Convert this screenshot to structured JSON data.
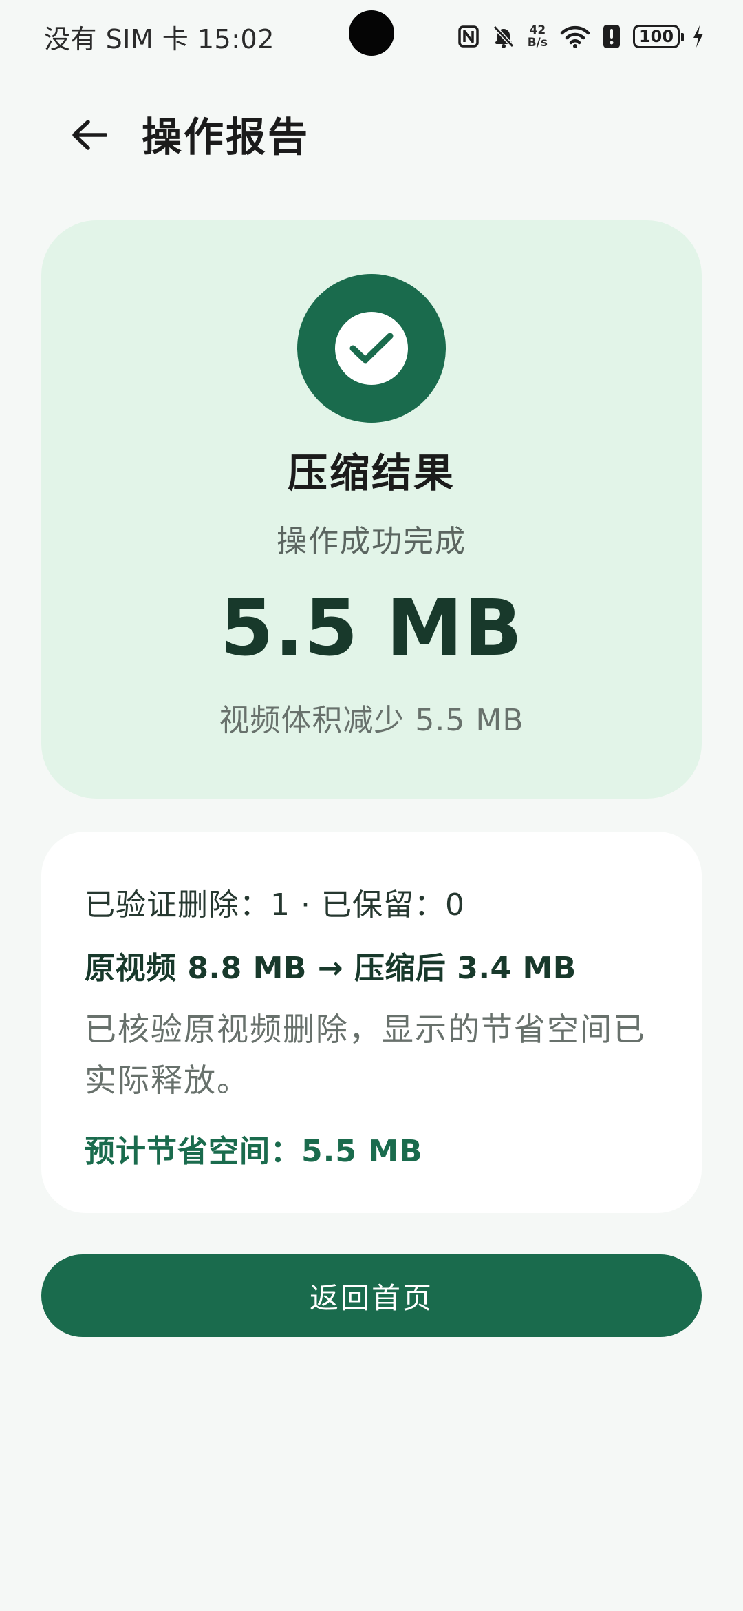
{
  "status_bar": {
    "carrier": "没有 SIM 卡",
    "time": "15:02",
    "net_speed_value": "42",
    "net_speed_unit": "B/s",
    "battery_level": "100",
    "icons": [
      "nfc-icon",
      "bell-off-icon",
      "wifi-icon",
      "alert-icon",
      "battery-icon",
      "charging-icon"
    ]
  },
  "app_bar": {
    "title": "操作报告",
    "back_icon": "arrow-left-icon"
  },
  "result_card": {
    "status_icon": "check-circle-icon",
    "title": "压缩结果",
    "subtitle": "操作成功完成",
    "saved_amount": "5.5 MB",
    "reduced_text": "视频体积减少 5.5 MB"
  },
  "detail_card": {
    "counts_line": "已验证删除：1 · 已保留：0",
    "size_line": "原视频 8.8 MB → 压缩后 3.4 MB",
    "note": "已核验原视频删除，显示的节省空间已实际释放。",
    "estimate_line": "预计节省空间：5.5 MB"
  },
  "actions": {
    "home_label": "返回首页"
  },
  "colors": {
    "accent": "#1a6b4d",
    "card_tint": "#e2f4e8",
    "background": "#f5f8f6"
  }
}
